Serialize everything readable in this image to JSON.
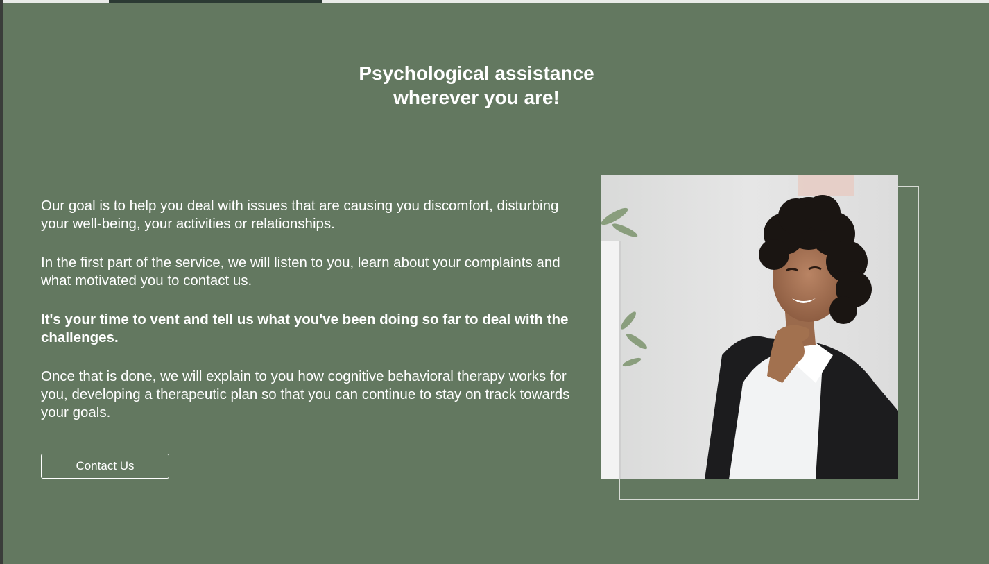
{
  "hero": {
    "title_line1": "Psychological assistance",
    "title_line2": "wherever you are!"
  },
  "content": {
    "paragraphs": [
      "Our goal is to help you deal with issues that are causing you discomfort, disturbing your well-being, your activities or relationships.",
      "In the first part of the service, we will listen to you, learn about your complaints and what motivated you to contact us.",
      "It's your time to vent and tell us what you've been doing so far to deal with the challenges.",
      "Once that is done, we will explain to you how cognitive behavioral therapy works for you, developing a therapeutic plan so that you can continue to stay on track towards your goals."
    ],
    "cta_label": "Contact Us"
  },
  "colors": {
    "background": "#637860",
    "text": "#ffffff",
    "frame": "#d7dbd5"
  },
  "image": {
    "subject": "smiling-woman-photo"
  }
}
